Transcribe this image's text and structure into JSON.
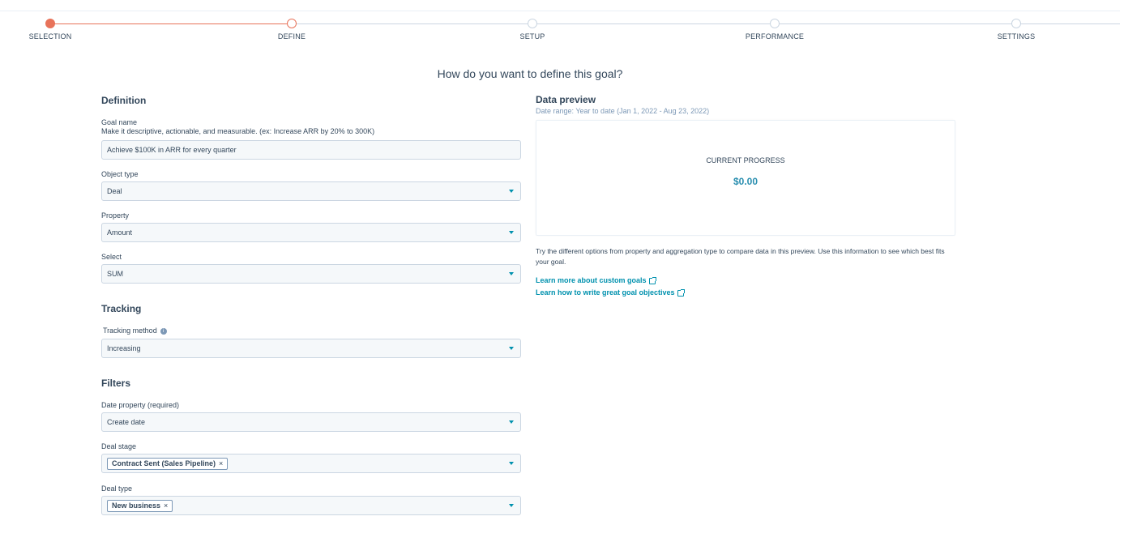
{
  "stepper": {
    "steps": [
      {
        "label": "SELECTION",
        "state": "done"
      },
      {
        "label": "DEFINE",
        "state": "current"
      },
      {
        "label": "SETUP",
        "state": "todo"
      },
      {
        "label": "PERFORMANCE",
        "state": "todo"
      },
      {
        "label": "SETTINGS",
        "state": "todo"
      }
    ],
    "accent_color": "#e8735a"
  },
  "headline": "How do you want to define this goal?",
  "definition": {
    "title": "Definition",
    "goal_name_label": "Goal name",
    "goal_name_help": "Make it descriptive, actionable, and measurable. (ex: Increase ARR by 20% to 300K)",
    "goal_name_value": "Achieve $100K in ARR for every quarter",
    "object_type_label": "Object type",
    "object_type_value": "Deal",
    "property_label": "Property",
    "property_value": "Amount",
    "select_label": "Select",
    "select_value": "SUM"
  },
  "tracking": {
    "title": "Tracking",
    "method_label": "Tracking method",
    "method_value": "Increasing"
  },
  "filters": {
    "title": "Filters",
    "date_property_label": "Date property (required)",
    "date_property_value": "Create date",
    "deal_stage_label": "Deal stage",
    "deal_stage_tag": "Contract Sent (Sales Pipeline)",
    "deal_type_label": "Deal type",
    "deal_type_tag": "New business",
    "tag_remove": "×"
  },
  "preview": {
    "title": "Data preview",
    "date_range": "Date range: Year to date (Jan 1, 2022 - Aug 23, 2022)",
    "progress_label": "CURRENT PROGRESS",
    "progress_value": "$0.00",
    "note": "Try the different options from property and aggregation type to compare data in this preview. Use this information to see which best fits your goal.",
    "link_custom_goals": "Learn more about custom goals",
    "link_objectives": "Learn how to write great goal objectives"
  },
  "colors": {
    "link": "#0091ae",
    "value": "#2b8fb0",
    "text": "#33475b"
  }
}
